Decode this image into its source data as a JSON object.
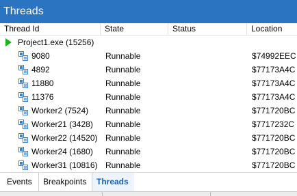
{
  "window": {
    "title": "Threads"
  },
  "columns": {
    "thread_id": "Thread Id",
    "state": "State",
    "status": "Status",
    "location": "Location"
  },
  "process": {
    "label": "Project1.exe (15256)",
    "icon": "play-icon",
    "color": "#18b418"
  },
  "threads": [
    {
      "id": "9080",
      "state": "Runnable",
      "status": "",
      "location": "$74992EEC"
    },
    {
      "id": "4892",
      "state": "Runnable",
      "status": "",
      "location": "$77173A4C"
    },
    {
      "id": "11880",
      "state": "Runnable",
      "status": "",
      "location": "$77173A4C"
    },
    {
      "id": "11376",
      "state": "Runnable",
      "status": "",
      "location": "$77173A4C"
    },
    {
      "id": "Worker2 (7524)",
      "state": "Runnable",
      "status": "",
      "location": "$771720BC"
    },
    {
      "id": "Worker21 (3428)",
      "state": "Runnable",
      "status": "",
      "location": "$7717232C"
    },
    {
      "id": "Worker22 (14520)",
      "state": "Runnable",
      "status": "",
      "location": "$771720BC"
    },
    {
      "id": "Worker24 (1680)",
      "state": "Runnable",
      "status": "",
      "location": "$771720BC"
    },
    {
      "id": "Worker31 (10816)",
      "state": "Runnable",
      "status": "",
      "location": "$771720BC"
    }
  ],
  "tabs": [
    {
      "label": "Events",
      "active": false
    },
    {
      "label": "Breakpoints",
      "active": false
    },
    {
      "label": "Threads",
      "active": true
    }
  ],
  "colors": {
    "titlebar": "#2a74c2",
    "active_tab_text": "#1c5ea9",
    "thread_icon": "#3b7fc8"
  }
}
